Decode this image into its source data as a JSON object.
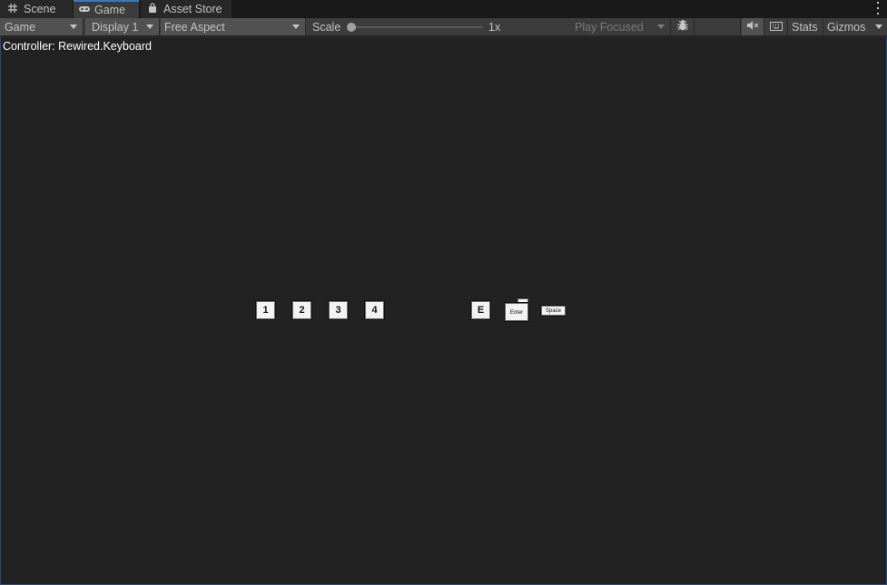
{
  "tabs": [
    {
      "label": "Scene",
      "icon": "grid-icon"
    },
    {
      "label": "Game",
      "icon": "gamepad-icon"
    },
    {
      "label": "Asset Store",
      "icon": "shopping-bag-icon"
    }
  ],
  "toolbar": {
    "game_view_label": "Game",
    "display_label": "Display 1",
    "aspect_label": "Free Aspect",
    "scale_label": "Scale",
    "scale_value": "1x",
    "play_mode_label": "Play Focused",
    "stats_label": "Stats",
    "gizmos_label": "Gizmos"
  },
  "viewport": {
    "controller_text": "Controller: Rewired.Keyboard",
    "keys": {
      "k1": "1",
      "k2": "2",
      "k3": "3",
      "k4": "4",
      "kE": "E",
      "kEnter": "Enter",
      "kSpace": "Space"
    }
  },
  "colors": {
    "accent": "#3a79bb",
    "viewport_bg": "#222222",
    "toolbar_bg": "#3c3c3c"
  }
}
